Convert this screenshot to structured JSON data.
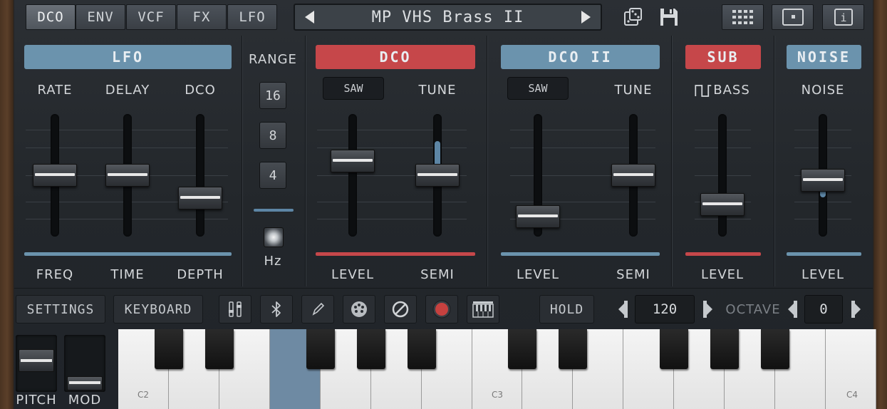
{
  "tabs": [
    "DCO",
    "ENV",
    "VCF",
    "FX",
    "LFO"
  ],
  "preset": {
    "name": "MP VHS Brass II"
  },
  "icons": {
    "prev": "left-arrow-icon",
    "next": "right-arrow-icon",
    "random": "dice-icon",
    "save": "floppy-disk-icon",
    "grid": "keypad-grid-icon",
    "window": "window-icon",
    "info": "info-icon"
  },
  "info_glyph": "i",
  "colors": {
    "blue_section": "#6b93ad",
    "red_section": "#c6474a",
    "accent_fill": "#5d86a5"
  },
  "lfo": {
    "title": "LFO",
    "top_labels": [
      "RATE",
      "DELAY",
      "DCO"
    ],
    "bottom_labels": [
      "FREQ",
      "TIME",
      "DEPTH"
    ],
    "levels": [
      0.5,
      0.5,
      0.22
    ]
  },
  "range": {
    "label": "RANGE",
    "options": [
      "16",
      "8",
      "4"
    ],
    "hz": "Hz"
  },
  "dco": {
    "title": "DCO",
    "wave": "SAW",
    "tune_label": "TUNE",
    "bottom_labels": [
      "LEVEL",
      "SEMI"
    ],
    "levels": [
      0.67,
      0.5
    ]
  },
  "dco2": {
    "title": "DCO II",
    "wave": "SAW",
    "tune_label": "TUNE",
    "bottom_labels": [
      "LEVEL",
      "SEMI"
    ],
    "levels": [
      0.0,
      0.5
    ]
  },
  "sub": {
    "title": "SUB",
    "top_label": "BASS",
    "bottom_label": "LEVEL",
    "level": 0.15
  },
  "noise": {
    "title": "NOISE",
    "top_label": "NOISE",
    "bottom_label": "LEVEL",
    "level": 0.44
  },
  "toolbar": {
    "settings": "SETTINGS",
    "keyboard": "KEYBOARD",
    "hold": "HOLD",
    "tempo": "120",
    "octave_label": "OCTAVE",
    "octave": "0",
    "icon_buttons": [
      "mixer-sliders-icon",
      "bluetooth-icon",
      "pen-icon",
      "palette-icon",
      "disable-icon",
      "record-icon",
      "piano-keys-icon"
    ]
  },
  "wheels": {
    "pitch": "PITCH",
    "mod": "MOD"
  },
  "keyboard": {
    "notes": [
      "C2",
      "C3",
      "C4"
    ],
    "pressed_key": "F2"
  }
}
